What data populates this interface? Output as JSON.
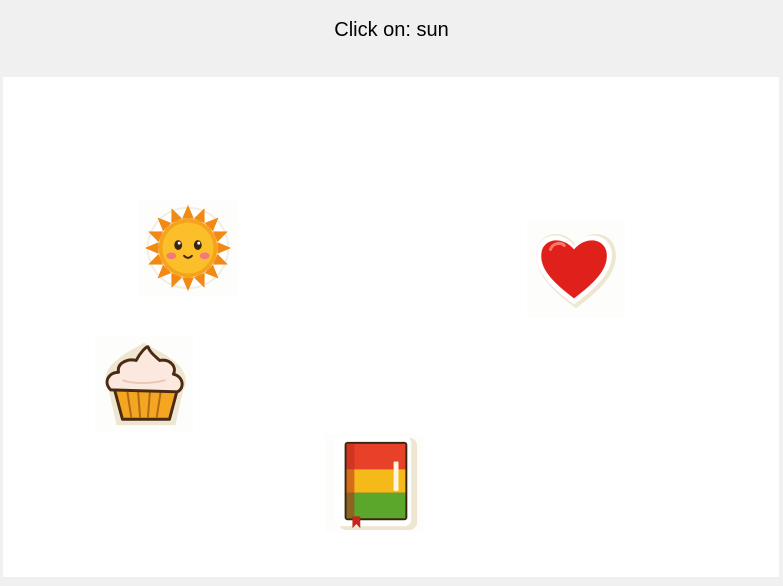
{
  "task": {
    "instruction": "Click on: sun"
  },
  "items": [
    {
      "name": "sun",
      "icon": "sun-icon"
    },
    {
      "name": "heart",
      "icon": "heart-icon"
    },
    {
      "name": "cupcake",
      "icon": "cupcake-icon"
    },
    {
      "name": "book",
      "icon": "book-icon"
    }
  ],
  "colors": {
    "header_bg": "#f0f0f0",
    "canvas_bg": "#ffffff",
    "sun": "#f7a21b",
    "heart": "#e0201b",
    "cupcake_wrapper": "#f4a521",
    "book_red": "#e8412a",
    "book_yellow": "#f6b91a",
    "book_green": "#5aa72c"
  }
}
